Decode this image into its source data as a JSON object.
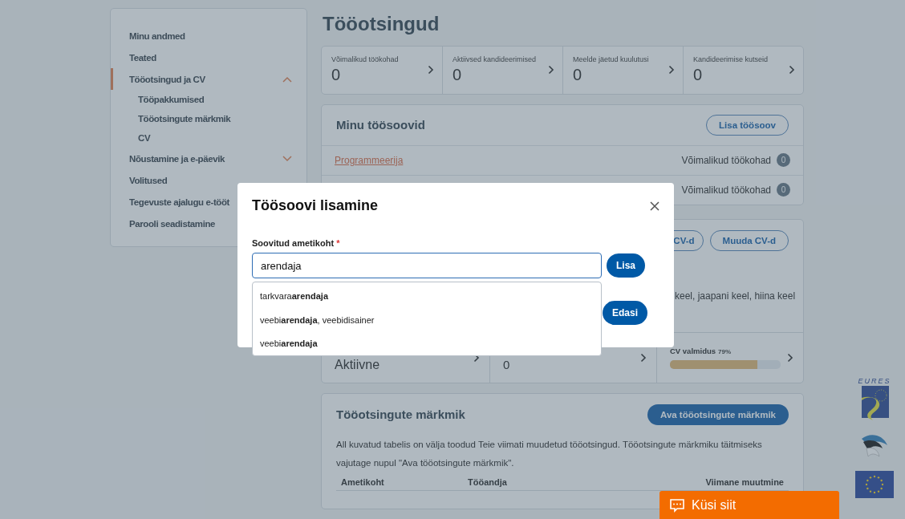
{
  "sidebar": {
    "items": [
      {
        "kind": "link",
        "label": "Minu andmed",
        "selected": false
      },
      {
        "kind": "link",
        "label": "Teated",
        "selected": false
      },
      {
        "kind": "group",
        "label": "Tööotsingud ja CV",
        "selected": true,
        "expanded": true,
        "children": [
          {
            "label": "Tööpakkumised",
            "selected": false
          },
          {
            "label": "Tööotsingute märkmik",
            "selected": false
          },
          {
            "label": "CV",
            "selected": false
          }
        ]
      },
      {
        "kind": "group",
        "label": "Nõustamine ja e-päevik",
        "selected": false,
        "expanded": false
      },
      {
        "kind": "link",
        "label": "Volitused",
        "selected": false
      },
      {
        "kind": "link",
        "label": "Tegevuste ajalugu e-tööt",
        "selected": false
      },
      {
        "kind": "link",
        "label": "Parooli seadistamine",
        "selected": false
      }
    ]
  },
  "page_title": "Tööotsingud",
  "stats": [
    {
      "label": "Võimalikud töökohad",
      "value": "0"
    },
    {
      "label": "Aktiivsed kandideerimised",
      "value": "0"
    },
    {
      "label": "Meelde jäetud kuulutusi",
      "value": "0"
    },
    {
      "label": "Kandideerimise kutseid",
      "value": "0"
    }
  ],
  "wishes": {
    "title": "Minu töösoovid",
    "add_button": "Lisa töösoov",
    "rows": [
      {
        "name": "Programmeerija",
        "label": "Võimalikud töökohad",
        "count": "0"
      },
      {
        "label": "Võimalikud töökohad",
        "count": "0"
      }
    ]
  },
  "cv": {
    "buttons": [
      "CV-d",
      "Muuda CV-d"
    ],
    "languages": "keel, jaapani keel, hiina keel",
    "cells": [
      {
        "kind": "text",
        "value": "Aktiivne"
      },
      {
        "kind": "text",
        "value": "0"
      },
      {
        "kind": "progress",
        "label": "CV valmidus",
        "reading": "79%",
        "level": 0.79
      }
    ]
  },
  "notes": {
    "title": "Tööotsingute märkmik",
    "button": "Ava tööotsingute märkmik",
    "text": "All kuvatud tabelis on välja toodud Teie viimati muudetud tööotsingud. Tööotsingute märkmiku täitmiseks vajutage nupul \"Ava tööotsingute märkmik\".",
    "columns": [
      "Ametikoht",
      "Tööandja",
      "Viimane muutmine"
    ]
  },
  "logos": {
    "eures": "EURES"
  },
  "chat": {
    "label": "Küsi siit"
  },
  "modal": {
    "title": "Töösoovi lisamine",
    "field": {
      "label": "Soovitud ametikoht",
      "required_mark": "*",
      "value": "arendaja"
    },
    "suggestions": [
      "tarkvara**arendaja**",
      "veebi**arendaja**, veebidisainer",
      "veebi**arendaja**"
    ],
    "buttons": [
      "Lisa",
      "Edasi"
    ]
  }
}
